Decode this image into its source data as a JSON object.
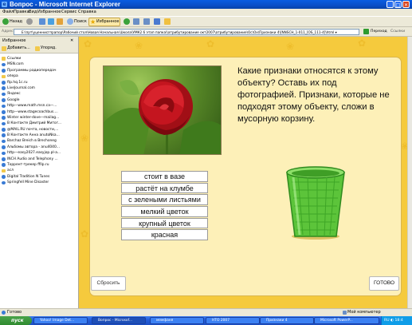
{
  "window": {
    "title": "Вопрос - Microsoft Internet Explorer",
    "minimize": "_",
    "maximize": "□",
    "close": "✕"
  },
  "menu": [
    "Файл",
    "Правка",
    "Вид",
    "Избранное",
    "Сервис",
    "Справка"
  ],
  "toolbar": {
    "back": "Назад",
    "search": "Поиск",
    "favorites": "Избранное"
  },
  "address": {
    "label": "Адрес:",
    "value": "E:\\прт\\уценнисгпрапор\\Рабочий стол\\Новая Начальная Школа\\УМК2 6 этап папка\\\\атрибутирование окт2007\\атрибутирование\\Ос\\Ох\\Признаки 4\\[NNSCH_1-011_[OS_111-4]\\html ▾",
    "go": "Переход",
    "links": "Ссылки"
  },
  "sidebar": {
    "title": "Избранное",
    "close": "✕",
    "add": "Добавить...",
    "organize": "Упоряд.",
    "items": [
      {
        "label": "Ссылки",
        "type": "folder"
      },
      {
        "label": "MSN.com",
        "type": "link"
      },
      {
        "label": "Программы радиопередач",
        "type": "link"
      },
      {
        "label": "опера",
        "type": "folder"
      },
      {
        "label": "ftp.hq.1c.ru",
        "type": "link"
      },
      {
        "label": "LiveJournal.com",
        "type": "link"
      },
      {
        "label": "Яндекс",
        "type": "link"
      },
      {
        "label": "Google",
        "type": "link"
      },
      {
        "label": "http—www.math.msn.ca—...",
        "type": "link"
      },
      {
        "label": "http—www.stagecoachbus....",
        "type": "link"
      },
      {
        "label": "Winter winter-dove—mailag...",
        "type": "link"
      },
      {
        "label": "В Контакте  Дмитрий Митог...",
        "type": "link"
      },
      {
        "label": "@MAIL.RU почта, новости,...",
        "type": "link"
      },
      {
        "label": "В Контакте  Анна anutoNka...",
        "type": "link"
      },
      {
        "label": "Barchaz Breich в Brechoneg",
        "type": "link"
      },
      {
        "label": "Альбомы автора - anu4040...",
        "type": "link"
      },
      {
        "label": "http—easy2027.easyjop.pl-a...",
        "type": "link"
      },
      {
        "label": "INCH Audio and Telephony ...",
        "type": "link"
      },
      {
        "label": "Торрент-трекер  ffilp.ru",
        "type": "link"
      },
      {
        "label": "асл",
        "type": "folder"
      },
      {
        "label": "Digital Tradition N Tunes",
        "type": "link"
      },
      {
        "label": "Springfell Mine Disaster",
        "type": "link"
      }
    ]
  },
  "quiz": {
    "question": "Какие признаки относятся к этому объекту? Оставь их под фотографией. Признаки, которые не подходят этому объекту, сложи в мусорную корзину.",
    "options": [
      "стоит в вазе",
      "растёт на клумбе",
      "с зелеными листьями",
      "мелкий цветок",
      "крупный цветок",
      "красная"
    ],
    "reset": "Сбросить",
    "done": "ГОТОВО"
  },
  "status": {
    "text": "Готово",
    "zone": "Мой компьютер"
  },
  "taskbar": {
    "start": "пуск",
    "tasks": [
      "Yahoo! Image Det...",
      "Вопрос - Microsof...",
      "мемфаня",
      "НТО 2007",
      "Признаки 4",
      "Microsoft PowerP..."
    ],
    "active_index": 1,
    "tray": "RU ◐ 18:4"
  },
  "colors": {
    "content_bg": "#f5ca3d",
    "panel_bg": "#fdf0b8",
    "basket": "#5cc43a"
  }
}
